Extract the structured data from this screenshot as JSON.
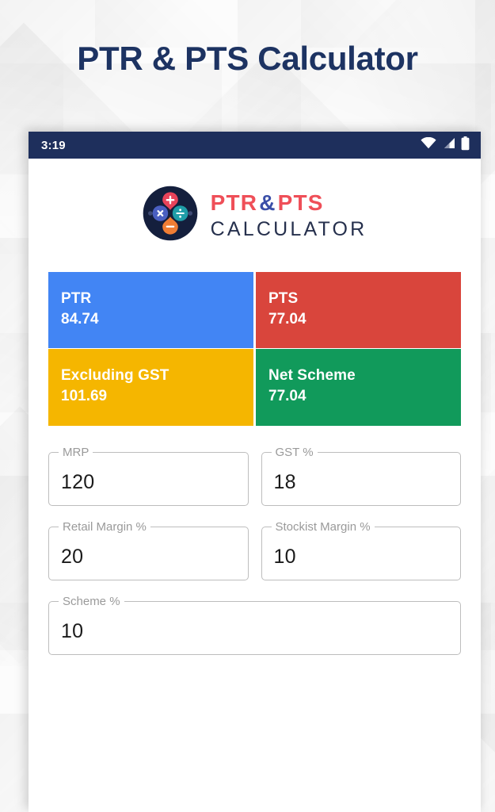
{
  "page": {
    "heading": "PTR & PTS Calculator",
    "heading_color": "#1d3362",
    "background_color": "#fcfcfc"
  },
  "status_bar": {
    "time": "3:19",
    "background_color": "#1e2f5c",
    "icons": [
      {
        "name": "wifi-icon",
        "label": "Wi-Fi signal full"
      },
      {
        "name": "cellular-signal-icon",
        "label": "Cellular signal"
      },
      {
        "name": "battery-icon",
        "label": "Battery full"
      }
    ]
  },
  "app": {
    "logo": {
      "mark_name": "ptr-pts-calculator-logo-mark",
      "mark_background": "#141f3d",
      "nodes": [
        {
          "name": "plus-node",
          "glyph": "+",
          "color": "#e8435a",
          "position": "top"
        },
        {
          "name": "multiply-node",
          "glyph": "×",
          "color": "#4a5fc1",
          "position": "left"
        },
        {
          "name": "divide-node",
          "glyph": "÷",
          "color": "#1f9da8",
          "position": "right"
        },
        {
          "name": "minus-node",
          "glyph": "−",
          "color": "#f07d34",
          "position": "bottom"
        }
      ],
      "wordmark": {
        "ptr": "PTR",
        "ampersand": "&",
        "pts": "PTS",
        "subtitle": "CALCULATOR",
        "ptr_color": "#ef4f58",
        "amp_color": "#3b4fa8",
        "subtitle_color": "#26304d"
      }
    }
  },
  "results": {
    "tiles": [
      {
        "name": "tile-ptr",
        "label": "PTR",
        "value": "84.74",
        "color": "#4285f4"
      },
      {
        "name": "tile-pts",
        "label": "PTS",
        "value": "77.04",
        "color": "#d9453c"
      },
      {
        "name": "tile-excluding-gst",
        "label": "Excluding GST",
        "value": "101.69",
        "color": "#f5b600"
      },
      {
        "name": "tile-net-scheme",
        "label": "Net Scheme",
        "value": "77.04",
        "color": "#119a5b"
      }
    ]
  },
  "form": {
    "fields": [
      {
        "name": "mrp-field",
        "label": "MRP",
        "value": "120"
      },
      {
        "name": "gst-percent-field",
        "label": "GST %",
        "value": "18"
      },
      {
        "name": "retail-margin-field",
        "label": "Retail Margin %",
        "value": "20"
      },
      {
        "name": "stockist-margin-field",
        "label": "Stockist Margin %",
        "value": "10"
      },
      {
        "name": "scheme-percent-field",
        "label": "Scheme %",
        "value": "10"
      }
    ]
  }
}
